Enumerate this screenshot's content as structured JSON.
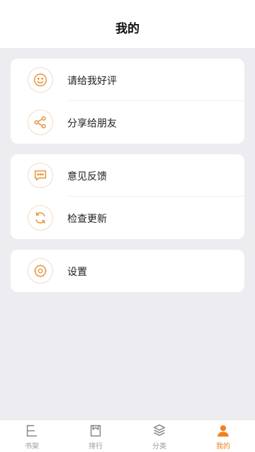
{
  "header": {
    "title": "我的"
  },
  "accent_color": "#f0821e",
  "groups": [
    {
      "items": [
        {
          "label": "请给我好评",
          "icon": "smile-icon"
        },
        {
          "label": "分享给朋友",
          "icon": "share-icon"
        }
      ]
    },
    {
      "items": [
        {
          "label": "意见反馈",
          "icon": "feedback-icon"
        },
        {
          "label": "检查更新",
          "icon": "refresh-icon"
        }
      ]
    },
    {
      "items": [
        {
          "label": "设置",
          "icon": "gear-icon"
        }
      ]
    }
  ],
  "tabbar": {
    "tabs": [
      {
        "label": "书架",
        "icon": "bookshelf-icon",
        "active": false
      },
      {
        "label": "排行",
        "icon": "ranking-icon",
        "active": false
      },
      {
        "label": "分类",
        "icon": "category-icon",
        "active": false
      },
      {
        "label": "我的",
        "icon": "user-icon",
        "active": true
      }
    ]
  }
}
